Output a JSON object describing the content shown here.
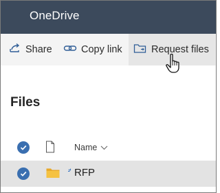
{
  "app": {
    "title": "OneDrive"
  },
  "toolbar": {
    "share_label": "Share",
    "copy_link_label": "Copy link",
    "request_files_label": "Request files"
  },
  "section": {
    "title": "Files"
  },
  "list": {
    "columns": {
      "name": "Name"
    },
    "rows": [
      {
        "name": "RFP",
        "type": "folder",
        "selected": true
      }
    ]
  },
  "colors": {
    "topbar": "#3c4a5c",
    "accent": "#3a6fb0",
    "selected_row": "#e3e3e3",
    "folder": "#f5c242"
  }
}
